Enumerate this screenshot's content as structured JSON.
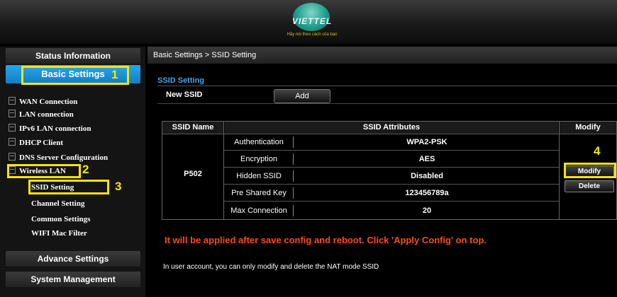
{
  "header": {
    "logo_text": "VIETTEL",
    "slogan": "Hãy nói theo cách của bạn"
  },
  "sidebar": {
    "status_info": "Status Information",
    "basic_settings": "Basic Settings",
    "items": [
      {
        "label": "WAN Connection"
      },
      {
        "label": "LAN connection"
      },
      {
        "label": "IPv6 LAN connection"
      },
      {
        "label": "DHCP Client"
      },
      {
        "label": "DNS Server Configuration"
      },
      {
        "label": "Wireless LAN"
      }
    ],
    "sub_items": [
      {
        "label": "SSID Setting"
      },
      {
        "label": "Channel Setting"
      },
      {
        "label": "Common Settings"
      },
      {
        "label": "WIFI Mac Filter"
      }
    ],
    "advance_settings": "Advance Settings",
    "system_management": "System Management"
  },
  "annotations": {
    "n1": "1",
    "n2": "2",
    "n3": "3",
    "n4": "4",
    "highlight_color": "#f5e600"
  },
  "main": {
    "breadcrumb": "Basic Settings > SSID Setting",
    "section_title": "SSID Setting",
    "new_ssid_label": "New SSID",
    "add_button": "Add",
    "table": {
      "headers": [
        "SSID Name",
        "SSID Attributes",
        "Modify"
      ],
      "ssid_name": "P502",
      "rows": [
        {
          "label": "Authentication",
          "value": "WPA2-PSK"
        },
        {
          "label": "Encryption",
          "value": "AES"
        },
        {
          "label": "Hidden SSID",
          "value": "Disabled"
        },
        {
          "label": "Pre Shared Key",
          "value": "123456789a"
        },
        {
          "label": "Max Connection",
          "value": "20"
        }
      ],
      "modify_button": "Modify",
      "delete_button": "Delete"
    },
    "warning": "It will be applied after save config and reboot. Click 'Apply Config' on top.",
    "note": "In user account, you can only modify and delete the NAT mode SSID",
    "colors": {
      "accent": "#2aa6e8",
      "warning": "#ff4a1c"
    }
  }
}
